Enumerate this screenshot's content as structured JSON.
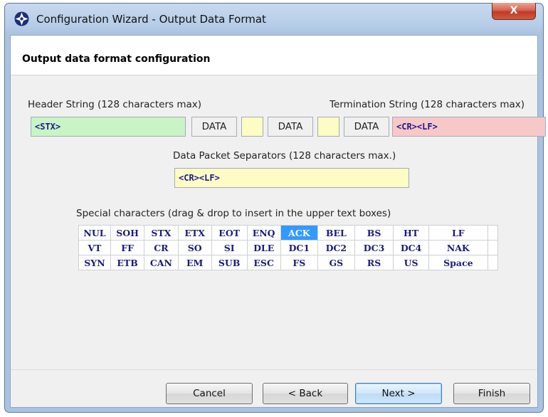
{
  "window": {
    "title": "Configuration Wizard - Output Data Format",
    "close_label": "X"
  },
  "section_title": "Output data format configuration",
  "header": {
    "label": "Header String (128 characters max)",
    "value": "<STX>"
  },
  "termination": {
    "label": "Termination String (128 characters max)",
    "value": "<CR><LF>"
  },
  "data_fields": [
    "DATA",
    "DATA",
    "DATA"
  ],
  "separator_fields": [
    "",
    ""
  ],
  "packet_separators": {
    "label": "Data Packet Separators (128 characters max.)",
    "value": "<CR><LF>"
  },
  "special_chars": {
    "label": "Special characters (drag & drop to insert in the upper text boxes)",
    "selected": "ACK",
    "rows": [
      [
        "NUL",
        "SOH",
        "STX",
        "ETX",
        "EOT",
        "ENQ",
        "ACK",
        "BEL",
        "BS",
        "HT",
        "LF"
      ],
      [
        "VT",
        "FF",
        "CR",
        "SO",
        "SI",
        "DLE",
        "DC1",
        "DC2",
        "DC3",
        "DC4",
        "NAK"
      ],
      [
        "SYN",
        "ETB",
        "CAN",
        "EM",
        "SUB",
        "ESC",
        "FS",
        "GS",
        "RS",
        "US",
        "Space"
      ]
    ]
  },
  "buttons": {
    "cancel": "Cancel",
    "back": "< Back",
    "next": "Next >",
    "finish": "Finish"
  },
  "colors": {
    "header_bg": "#c9f4c5",
    "termination_bg": "#f8c8c8",
    "separator_bg": "#fcfcc4",
    "selected": "#3399ff"
  }
}
